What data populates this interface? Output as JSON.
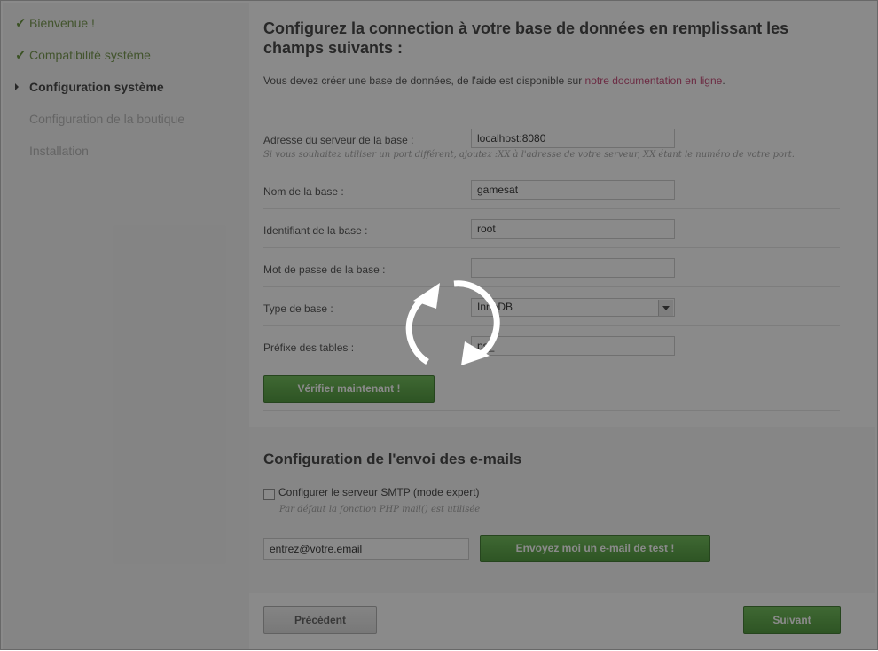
{
  "sidebar": {
    "steps": [
      {
        "label": "Bienvenue !",
        "state": "done"
      },
      {
        "label": "Compatibilité système",
        "state": "done"
      },
      {
        "label": "Configuration système",
        "state": "current"
      },
      {
        "label": "Configuration de la boutique",
        "state": "pending"
      },
      {
        "label": "Installation",
        "state": "pending"
      }
    ]
  },
  "db": {
    "title": "Configurez la connection à votre base de données en remplissant les champs suivants :",
    "intro_text": "Vous devez créer une base de données, de l'aide est disponible sur",
    "intro_link": "notre documentation en ligne",
    "intro_end": ".",
    "server_label": "Adresse du serveur de la base :",
    "server_value": "localhost:8080",
    "server_hint": "Si vous souhaitez utiliser un port différent, ajoutez :XX à l'adresse de votre serveur, XX étant le numéro de votre port.",
    "name_label": "Nom de la base :",
    "name_value": "gamesat",
    "login_label": "Identifiant de la base :",
    "login_value": "root",
    "password_label": "Mot de passe de la base :",
    "password_value": "",
    "engine_label": "Type de base :",
    "engine_value": "InnoDB",
    "prefix_label": "Préfixe des tables :",
    "prefix_value": "ps_",
    "check_button": "Vérifier maintenant !"
  },
  "mail": {
    "title": "Configuration de l'envoi des e-mails",
    "smtp_label": "Configurer le serveur SMTP (mode expert)",
    "smtp_checked": false,
    "smtp_hint": "Par défaut la fonction PHP mail() est utilisée",
    "email_value": "entrez@votre.email",
    "test_button": "Envoyez moi un e-mail de test !"
  },
  "nav": {
    "previous": "Précédent",
    "next": "Suivant"
  },
  "colors": {
    "accent_green": "#4a9e34",
    "link": "#c03a6b",
    "overlay": "rgba(30,30,30,0.52)"
  },
  "loading": {
    "icon": "refresh-icon",
    "visible": true
  }
}
